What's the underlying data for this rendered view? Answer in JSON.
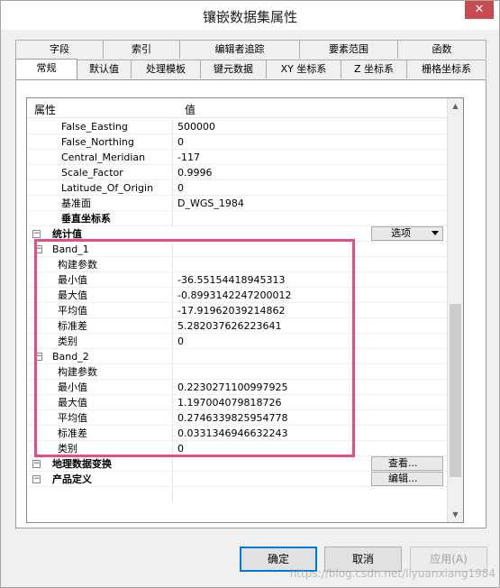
{
  "window": {
    "title": "镶嵌数据集属性",
    "close_label": "✕"
  },
  "tabs_back": [
    {
      "label": "字段"
    },
    {
      "label": "索引"
    },
    {
      "label": "编辑者追踪"
    },
    {
      "label": "要素范围"
    },
    {
      "label": "函数"
    }
  ],
  "tabs_front": [
    {
      "label": "常规"
    },
    {
      "label": "默认值"
    },
    {
      "label": "处理模板"
    },
    {
      "label": "键元数据"
    },
    {
      "label": "XY 坐标系"
    },
    {
      "label": "Z 坐标系"
    },
    {
      "label": "栅格坐标系"
    }
  ],
  "grid": {
    "header_property": "属性",
    "header_value": "值",
    "rows": [
      {
        "name": "False_Easting",
        "value": "500000"
      },
      {
        "name": "False_Northing",
        "value": "0"
      },
      {
        "name": "Central_Meridian",
        "value": "-117"
      },
      {
        "name": "Scale_Factor",
        "value": "0.9996"
      },
      {
        "name": "Latitude_Of_Origin",
        "value": "0"
      },
      {
        "name": "基准面",
        "value": "D_WGS_1984"
      },
      {
        "name": "垂直坐标系",
        "value": ""
      },
      {
        "name": "统计值",
        "value": ""
      },
      {
        "name": "Band_1",
        "value": ""
      },
      {
        "name": "构建参数",
        "value": ""
      },
      {
        "name": "最小值",
        "value": "-36.55154418945313"
      },
      {
        "name": "最大值",
        "value": "-0.8993142247200012"
      },
      {
        "name": "平均值",
        "value": "-17.91962039214862"
      },
      {
        "name": "标准差",
        "value": "5.282037626223641"
      },
      {
        "name": "类别",
        "value": "0"
      },
      {
        "name": "Band_2",
        "value": ""
      },
      {
        "name": "构建参数",
        "value": ""
      },
      {
        "name": "最小值",
        "value": "0.2230271100997925"
      },
      {
        "name": "最大值",
        "value": "1.197004079818726"
      },
      {
        "name": "平均值",
        "value": "0.2746339825954778"
      },
      {
        "name": "标准差",
        "value": "0.0331346946632243"
      },
      {
        "name": "类别",
        "value": "0"
      },
      {
        "name": "地理数据变换",
        "value": ""
      },
      {
        "name": "产品定义",
        "value": ""
      }
    ],
    "options_button": "选项",
    "view_button": "查看...",
    "edit_button": "编辑..."
  },
  "buttons": {
    "ok": "确定",
    "cancel": "取消",
    "apply": "应用(A)"
  },
  "watermark": "https://blog.csdn.net/liyuanxiang1984",
  "colors": {
    "highlight": "#e64d86",
    "close": "#c74b50",
    "default_border": "#0078d7"
  }
}
